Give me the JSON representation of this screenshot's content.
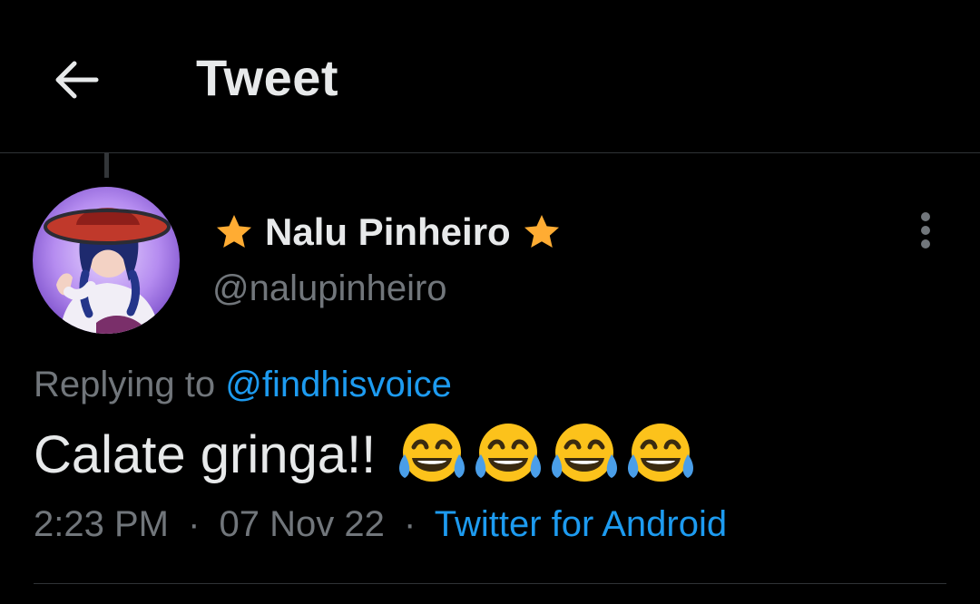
{
  "header": {
    "back_icon": "arrow-left-icon",
    "title": "Tweet"
  },
  "author": {
    "display_name": "Nalu Pinheiro",
    "handle": "@nalupinheiro",
    "name_decoration_icon": "star-icon",
    "star_color": "#ffac33",
    "avatar_icon": "profile-photo"
  },
  "tweet": {
    "reply_prefix": "Replying to",
    "reply_to": "@findhisvoice",
    "text": "Calate gringa!!",
    "emojis": [
      "face-with-tears-of-joy",
      "face-with-tears-of-joy",
      "face-with-tears-of-joy",
      "face-with-tears-of-joy"
    ],
    "time": "2:23 PM",
    "date": "07 Nov 22",
    "source": "Twitter for Android",
    "separator": "·"
  },
  "menu": {
    "more_icon": "vertical-ellipsis-icon"
  },
  "colors": {
    "background": "#000000",
    "text_primary": "#e7e9ea",
    "text_secondary": "#71767b",
    "link": "#1d9bf0",
    "divider": "#2f3336"
  }
}
